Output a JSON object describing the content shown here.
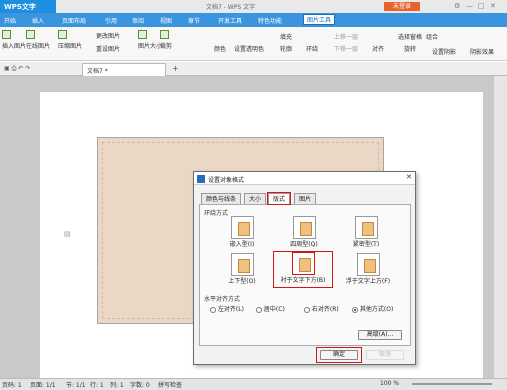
{
  "app": {
    "logo": "WPS文字",
    "title": "文档7 - WPS 文字",
    "unlogged": "未登录"
  },
  "menu": [
    "开始",
    "插入",
    "页面布局",
    "引用",
    "审阅",
    "视图",
    "章节",
    "开发工具",
    "特色功能",
    "图片工具"
  ],
  "ribbon": {
    "row1": [
      "插入图片",
      "在线图片",
      "压缩图片",
      "更改图片",
      "重设图片",
      "图片大小",
      "裁剪",
      "颜色",
      "设置透明色",
      "轮廓",
      "填充",
      "环绕",
      "上移一层",
      "选择窗格",
      "组合",
      "设置阴影",
      "阴影效果"
    ],
    "row2": [
      "下移一层",
      "对齐",
      "旋转"
    ]
  },
  "doc_tab": "文档7 *",
  "status": {
    "items": [
      "页码: 1",
      "页面: 1/1",
      "节: 1/1",
      "行: 1",
      "列: 1",
      "字数: 0",
      "拼写检查"
    ],
    "zoom": "100 %"
  },
  "dialog": {
    "title": "设置对象格式",
    "tabs": [
      "颜色与线条",
      "大小",
      "版式",
      "图片"
    ],
    "section_wrap": "环绕方式",
    "wrap_options": [
      "嵌入型(I)",
      "四周型(Q)",
      "紧密型(T)",
      "上下型(O)",
      "衬于文字下方(B)",
      "浮于文字上方(F)"
    ],
    "section_align": "水平对齐方式",
    "align_options": [
      "左对齐(L)",
      "居中(C)",
      "右对齐(R)",
      "其他方式(O)"
    ],
    "advanced": "高级(A)...",
    "ok": "确定",
    "cancel": "取消"
  },
  "colors": {
    "accent": "#3a95de",
    "highlight": "#d21616"
  }
}
